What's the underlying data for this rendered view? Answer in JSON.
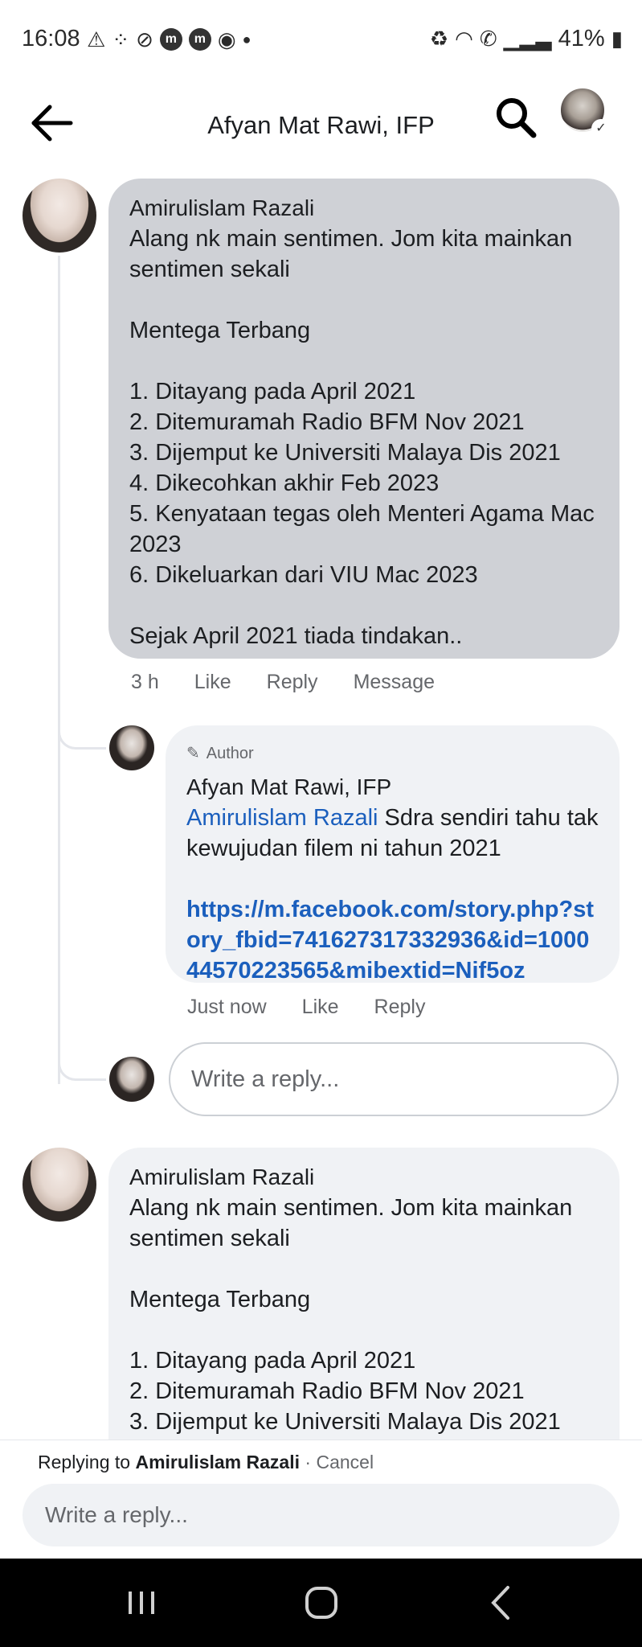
{
  "status_bar": {
    "time": "16:08",
    "left_icons": [
      "warning-icon",
      "grid-icon",
      "no-sync-icon",
      "m-icon",
      "m-icon",
      "messenger-icon",
      "dot-icon"
    ],
    "battery": "41%"
  },
  "header": {
    "title": "Afyan Mat Rawi, IFP"
  },
  "comment1": {
    "author": "Amirulislam Razali",
    "text": "Alang nk main sentimen. Jom kita mainkan sentimen sekali\n\nMentega Terbang\n\n1. Ditayang pada April 2021\n2. Ditemuramah Radio BFM Nov 2021\n3. Dijemput ke Universiti Malaya Dis 2021\n4. Dikecohkan akhir Feb 2023\n5. Kenyataan tegas oleh Menteri Agama Mac 2023\n6. Dikeluarkan dari VIU Mac 2023\n\nSejak April 2021 tiada tindakan..",
    "time": "3 h",
    "like": "Like",
    "reply": "Reply",
    "message": "Message"
  },
  "reply1": {
    "badge": "Author",
    "author": "Afyan Mat Rawi, IFP",
    "mention": "Amirulislam Razali",
    "text": " Sdra sendiri tahu tak kewujudan filem ni tahun 2021",
    "link": "https://m.facebook.com/story.php?story_fbid=741627317332936&id=100044570223565&mibextid=Nif5oz",
    "time": "Just now",
    "like": "Like",
    "reply": "Reply"
  },
  "reply_box": {
    "placeholder": "Write a reply..."
  },
  "comment2": {
    "author": "Amirulislam Razali",
    "text": "Alang nk main sentimen. Jom kita mainkan sentimen sekali\n\nMentega Terbang\n\n1. Ditayang pada April 2021\n2. Ditemuramah Radio BFM Nov 2021\n3. Dijemput ke Universiti Malaya Dis 2021"
  },
  "composer": {
    "replying_prefix": "Replying to ",
    "replying_name": "Amirulislam Razali",
    "separator": " · ",
    "cancel": "Cancel",
    "placeholder": "Write a reply..."
  }
}
